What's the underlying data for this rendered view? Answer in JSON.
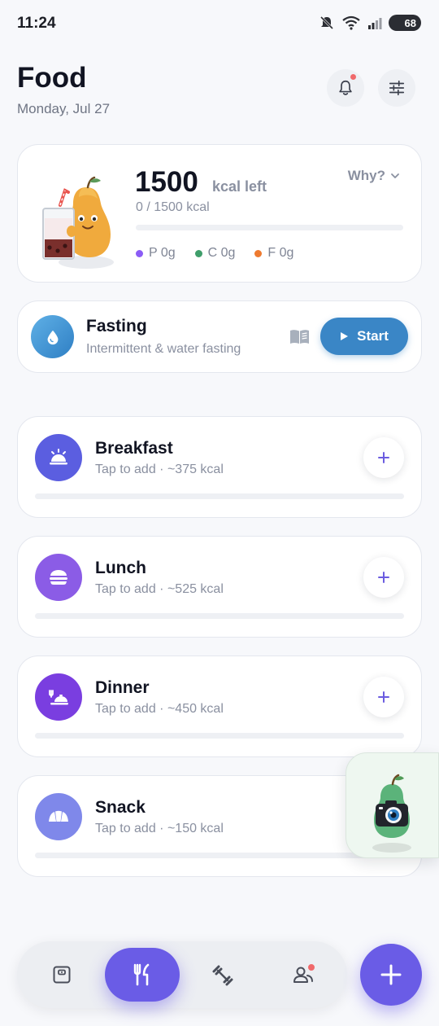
{
  "status_bar": {
    "time": "11:24",
    "battery": "68"
  },
  "header": {
    "title": "Food",
    "date": "Monday, Jul 27"
  },
  "summary": {
    "kcal_left": "1500",
    "kcal_left_unit": "kcal left",
    "consumed_text": "0 / 1500 kcal",
    "progress": 0,
    "why_label": "Why?",
    "macros": [
      {
        "label": "P 0g",
        "color": "#8b5cf6"
      },
      {
        "label": "C 0g",
        "color": "#3f9e6a"
      },
      {
        "label": "F 0g",
        "color": "#ee7a2f"
      }
    ]
  },
  "fasting": {
    "title": "Fasting",
    "subtitle": "Intermittent & water fasting",
    "start_label": "Start"
  },
  "meals": [
    {
      "name": "Breakfast",
      "subtitle": "Tap to add · ~375 kcal",
      "icon": "sunrise-dish-icon",
      "color": "#5b5ee0",
      "progress": 0
    },
    {
      "name": "Lunch",
      "subtitle": "Tap to add · ~525 kcal",
      "icon": "burger-icon",
      "color": "#8b5ce6",
      "progress": 0
    },
    {
      "name": "Dinner",
      "subtitle": "Tap to add · ~450 kcal",
      "icon": "serving-dish-icon",
      "color": "#7a3ee0",
      "progress": 0
    },
    {
      "name": "Snack",
      "subtitle": "Tap to add · ~150 kcal",
      "icon": "croissant-icon",
      "color": "#7f88ea",
      "progress": 0
    }
  ],
  "bottom_nav": {
    "items": [
      {
        "icon": "scale-icon",
        "active": false
      },
      {
        "icon": "fork-knife-icon",
        "active": true
      },
      {
        "icon": "dumbbell-icon",
        "active": false
      },
      {
        "icon": "community-icon",
        "active": false,
        "badge": true
      }
    ]
  },
  "colors": {
    "accent": "#6a5ce6",
    "start_button": "#3a86c6",
    "notification": "#f0696b"
  }
}
